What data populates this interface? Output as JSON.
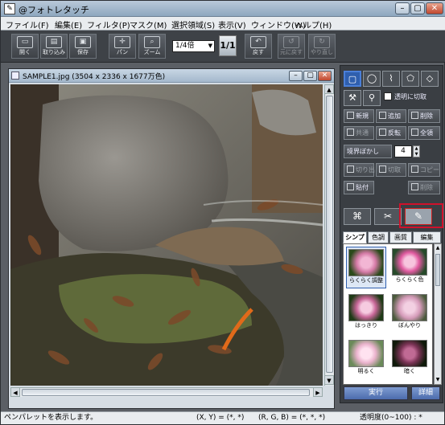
{
  "window": {
    "title": "@フォトレタッチ"
  },
  "menu": [
    "ファイル(F)",
    "編集(E)",
    "フィルタ(P)",
    "マスク(M)",
    "選択領域(S)",
    "表示(V)",
    "ウィンドウ(W)",
    "ヘルプ(H)"
  ],
  "toolbar": {
    "open": "開く",
    "import": "取り込み",
    "save": "保存",
    "pan": "パン",
    "zoom": "ズーム",
    "zoom_level": "1/4倍",
    "fit": "1/1",
    "return": "戻す",
    "undo": "元に戻す",
    "redo": "やり直し"
  },
  "document": {
    "title": "SAMPLE1.jpg (3504 x 2336 x 1677万色)"
  },
  "panel": {
    "apply_to_selection": "透明に切取",
    "buttons": {
      "new": "新規",
      "add": "追加",
      "subtract": "削除",
      "common": "共通",
      "invert": "反転",
      "all": "全領",
      "blur": "境界ぼかし",
      "cut": "切り出",
      "copy": "切取",
      "paste_copy": "コピー",
      "paste": "貼付",
      "delete": "削除"
    },
    "blur_value": "4",
    "subtabs": [
      "シンプル",
      "色調",
      "画質",
      "編集"
    ],
    "effects": [
      {
        "label": "らくらく調整"
      },
      {
        "label": "らくらく色"
      },
      {
        "label": "はっきり"
      },
      {
        "label": "ぼんやり"
      },
      {
        "label": "明るく"
      },
      {
        "label": "暗く"
      }
    ],
    "run": "実行",
    "details": "詳細"
  },
  "status": {
    "message": "ペンパレットを表示します。",
    "coords": "(X, Y) = (*, *)",
    "rgb": "(R, G, B) = (*, *, *)",
    "opacity": "透明度(0~100) : *"
  },
  "colors": {
    "highlight": "#d0112b",
    "accent": "#2f5fae"
  }
}
